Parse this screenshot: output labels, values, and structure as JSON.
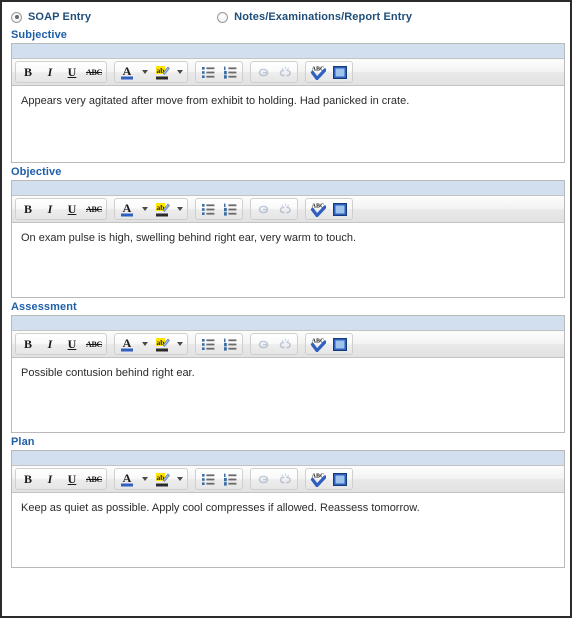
{
  "entry_mode": {
    "options": [
      {
        "label": "SOAP Entry",
        "selected": true,
        "name": "soap-entry"
      },
      {
        "label": "Notes/Examinations/Report Entry",
        "selected": false,
        "name": "notes-examinations-report-entry"
      }
    ]
  },
  "toolbar": {
    "groups": [
      {
        "name": "text-style-group",
        "buttons": [
          {
            "name": "bold-icon",
            "glyph": "B",
            "kind": "bold"
          },
          {
            "name": "italic-icon",
            "glyph": "I",
            "kind": "italic"
          },
          {
            "name": "underline-icon",
            "glyph": "U",
            "kind": "underline"
          },
          {
            "name": "strikethrough-icon",
            "glyph": "ABC",
            "kind": "strike"
          }
        ]
      },
      {
        "name": "color-group",
        "buttons": [
          {
            "name": "font-color-icon",
            "glyph": "A",
            "kind": "fontcolor"
          },
          {
            "name": "font-color-dropdown-icon",
            "glyph": "",
            "kind": "caret"
          },
          {
            "name": "highlight-color-icon",
            "glyph": "ab",
            "kind": "highlight"
          },
          {
            "name": "highlight-color-dropdown-icon",
            "glyph": "",
            "kind": "caret"
          }
        ]
      },
      {
        "name": "list-group",
        "buttons": [
          {
            "name": "bulleted-list-icon",
            "glyph": "",
            "kind": "bullets"
          },
          {
            "name": "numbered-list-icon",
            "glyph": "",
            "kind": "numbers"
          }
        ]
      },
      {
        "name": "link-group",
        "buttons": [
          {
            "name": "insert-link-icon",
            "glyph": "",
            "kind": "link"
          },
          {
            "name": "remove-link-icon",
            "glyph": "",
            "kind": "unlink"
          }
        ]
      },
      {
        "name": "tools-group",
        "buttons": [
          {
            "name": "spell-check-icon",
            "glyph": "",
            "kind": "spellcheck"
          },
          {
            "name": "full-screen-icon",
            "glyph": "",
            "kind": "maximize"
          }
        ]
      }
    ]
  },
  "sections": [
    {
      "name": "subjective",
      "label": "Subjective",
      "text": "Appears very agitated after move from exhibit to holding. Had panicked in crate.",
      "body_height": 64
    },
    {
      "name": "objective",
      "label": "Objective",
      "text": "On exam pulse is high, swelling behind right ear, very warm to touch.",
      "body_height": 62
    },
    {
      "name": "assessment",
      "label": "Assessment",
      "text": "Possible contusion behind right ear.",
      "body_height": 62
    },
    {
      "name": "plan",
      "label": "Plan",
      "text": "Keep as quiet as possible. Apply cool compresses if allowed. Reassess tomorrow.",
      "body_height": 62
    }
  ],
  "colors": {
    "heading_blue": "#1f5fa8",
    "radio_label_blue": "#1f4e79",
    "editor_topbar_blue": "#d2dfee",
    "border_gray": "#b9b9b9",
    "frame_black": "#2b2b2b"
  }
}
